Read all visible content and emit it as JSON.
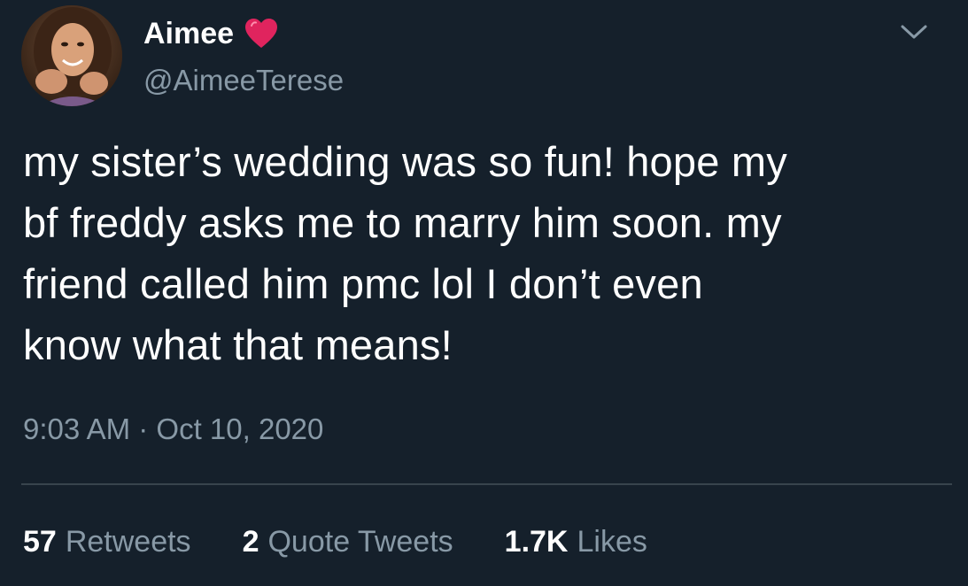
{
  "user": {
    "display_name": "Aimee",
    "handle": "@AimeeTerese",
    "badge_icon": "red-heart-emoji",
    "badge_color": "#e0245e"
  },
  "tweet": {
    "lines": [
      "my sister’s wedding was so fun! hope my",
      "bf freddy asks me to marry him soon. my",
      "friend called him pmc lol I don’t even",
      "know what that means!"
    ],
    "time": "9:03 AM",
    "separator": "·",
    "date": "Oct 10, 2020"
  },
  "stats": {
    "retweets": {
      "count": "57",
      "label": "Retweets"
    },
    "quote_tweets": {
      "count": "2",
      "label": "Quote Tweets"
    },
    "likes": {
      "count": "1.7K",
      "label": "Likes"
    }
  },
  "colors": {
    "background": "#15202b",
    "text_primary": "#ffffff",
    "text_secondary": "#8899a6",
    "divider": "#38444d"
  },
  "icons": {
    "menu": "chevron-down-icon"
  }
}
